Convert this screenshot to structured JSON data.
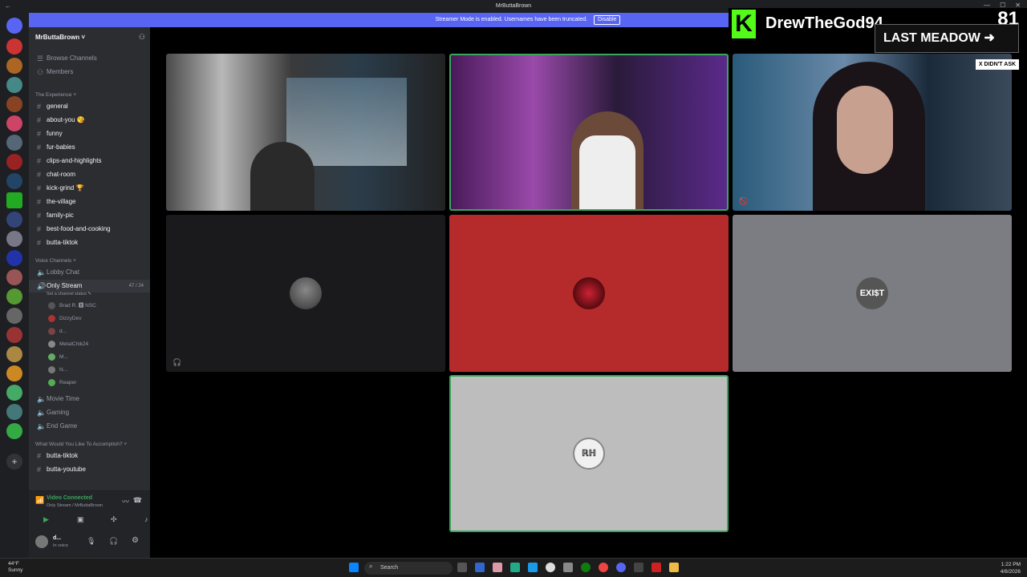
{
  "window": {
    "title": "MrButtaBrown",
    "back_glyph": "←",
    "min": "—",
    "max": "☐",
    "close": "✕"
  },
  "streamer": {
    "message": "Streamer Mode is enabled. Usernames have been truncated.",
    "button": "Disable"
  },
  "server": {
    "name": "MrButtaBrown ˅",
    "invite_icon": "person-plus-icon"
  },
  "nav": {
    "browse": "Browse Channels",
    "members": "Members"
  },
  "categories": {
    "experience": "The Experience ˅",
    "voice": "Voice Channels ˅",
    "accomplish": "What Would You Like To Accomplish? ˅"
  },
  "text_channels": [
    "general",
    "about-you 😘",
    "funny",
    "fur-babies",
    "clips-and-highlights",
    "chat-room",
    "kick-grind 🏆",
    "the-village",
    "family-pic",
    "best-food-and-cooking",
    "butta-tiktok"
  ],
  "voice_channels": {
    "lobby": "Lobby Chat",
    "only_stream": "Only Stream",
    "only_stream_count": "47 / 24",
    "status": "Set a channel status ✎",
    "movie": "Movie Time",
    "gaming": "Gaming",
    "end": "End Game"
  },
  "members": [
    "Brad R. 🅱 NSC",
    "DizzyDev",
    "d...",
    "MetalChik24",
    "M...",
    "N...",
    "Reaper"
  ],
  "extra_channels": [
    "butta-tiktok",
    "butta-youtube"
  ],
  "voice_connected": {
    "title": "Video Connected",
    "sub": "Only Stream / MrButtaBrown"
  },
  "user": {
    "name": "d...",
    "status": "In voice"
  },
  "overlay": {
    "k": "K",
    "streamer_name": "DrewTheGod94",
    "viewers": "81",
    "banner": "LAST MEADOW ➜",
    "tag": "X DIDN'T ASK"
  },
  "tiles": {
    "avatar_exist": "EXI$T",
    "avatar_rh": "ℝℍ"
  },
  "taskbar": {
    "search": "Search",
    "weather_temp": "44°F",
    "weather_desc": "Sunny",
    "time": "1:22 PM",
    "date": "4/8/2026"
  },
  "colors": {
    "brand": "#5865f2",
    "kick": "#53fc18",
    "red_tile": "#b52a2a",
    "grey_tile": "#7b7d82",
    "light_tile": "#bdbdbd",
    "speaking": "#3ba55c"
  },
  "server_badges": [
    "34",
    "1",
    "5",
    "6",
    "5",
    "7",
    "32",
    "40",
    "124",
    "34",
    "787"
  ]
}
